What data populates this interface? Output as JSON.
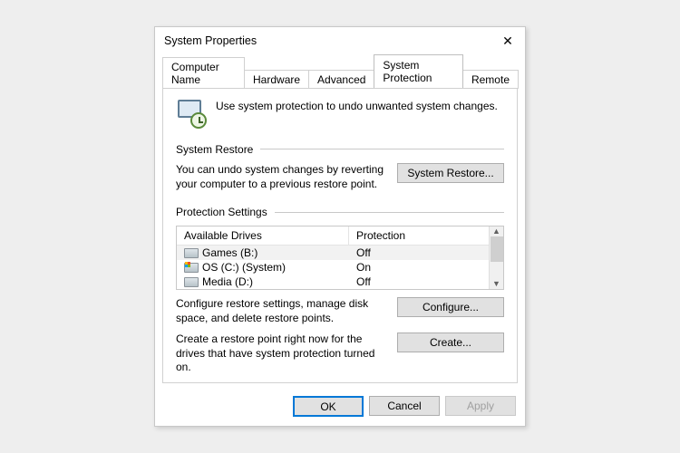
{
  "title": "System Properties",
  "tabs": {
    "computer_name": "Computer Name",
    "hardware": "Hardware",
    "advanced": "Advanced",
    "system_protection": "System Protection",
    "remote": "Remote"
  },
  "intro_text": "Use system protection to undo unwanted system changes.",
  "system_restore": {
    "label": "System Restore",
    "desc": "You can undo system changes by reverting your computer to a previous restore point.",
    "button": "System Restore..."
  },
  "protection_settings": {
    "label": "Protection Settings",
    "col_drives": "Available Drives",
    "col_protection": "Protection",
    "drives": [
      {
        "name": "Games (B:)",
        "protection": "Off"
      },
      {
        "name": "OS (C:) (System)",
        "protection": "On"
      },
      {
        "name": "Media (D:)",
        "protection": "Off"
      }
    ],
    "configure_desc": "Configure restore settings, manage disk space, and delete restore points.",
    "configure_button": "Configure...",
    "create_desc": "Create a restore point right now for the drives that have system protection turned on.",
    "create_button": "Create..."
  },
  "footer": {
    "ok": "OK",
    "cancel": "Cancel",
    "apply": "Apply"
  }
}
